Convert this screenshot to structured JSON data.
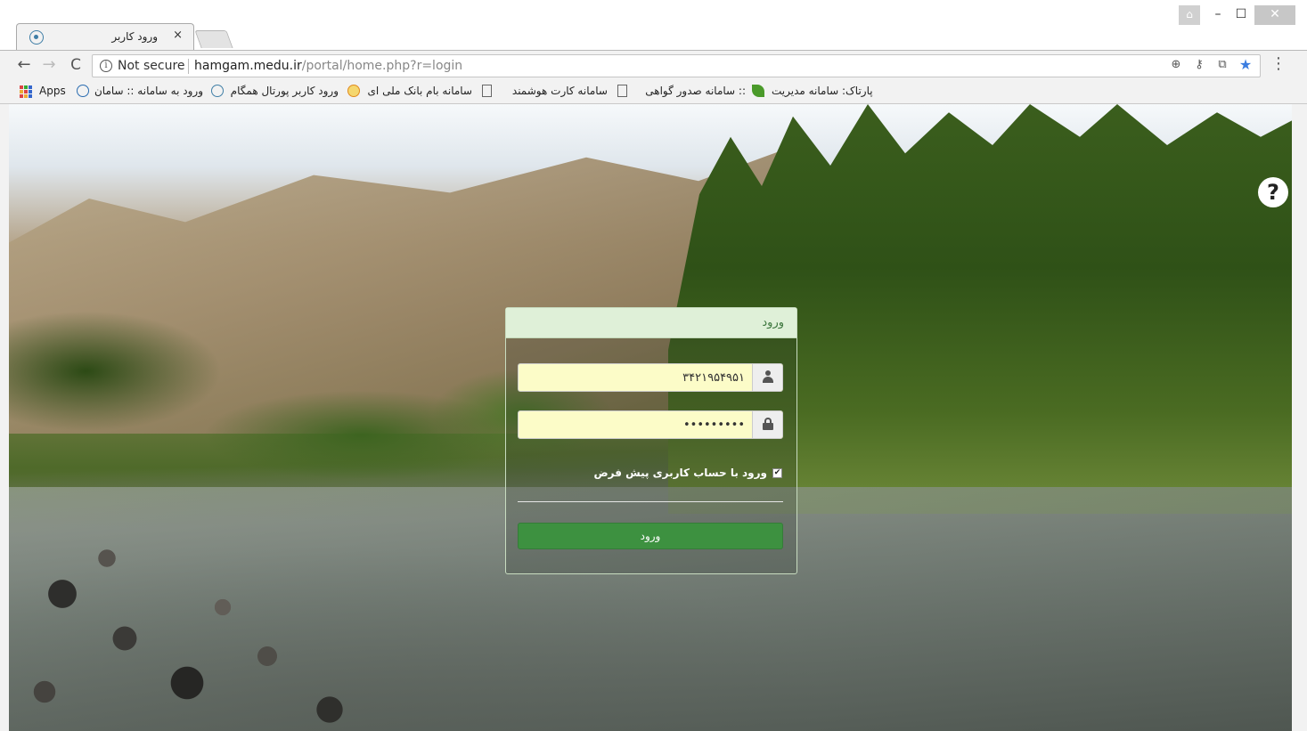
{
  "tab": {
    "title": "ورود کاربر",
    "close": "×"
  },
  "window_controls": {
    "user": "⌂",
    "minimize": "–",
    "maximize": "☐",
    "close": "✕"
  },
  "toolbar": {
    "back": "←",
    "forward": "→",
    "reload": "C",
    "security_icon": "i",
    "security_text": "Not secure",
    "url_host": "hamgam.medu.ir",
    "url_path": "/portal/home.php?r=login",
    "zoom_icon": "⊕",
    "key_icon": "⚷",
    "translate_icon": "⧉",
    "star_icon": "★",
    "menu_icon": "⋮"
  },
  "bookmarks": [
    {
      "label": "Apps",
      "icon": "apps-grid-icon"
    },
    {
      "label": "ورود به سامانه :: سامان",
      "icon": "circle-logo-icon"
    },
    {
      "label": "ورود کاربر پورتال همگام",
      "icon": "portal-icon"
    },
    {
      "label": "سامانه بام بانک ملی ای",
      "icon": "bank-icon"
    },
    {
      "label": "سامانه کارت هوشمند",
      "icon": "page-icon"
    },
    {
      "label": ":: سامانه صدور گواهی",
      "icon": "page-icon"
    },
    {
      "label": "پارتاک: سامانه مدیریت",
      "icon": "leaf-icon"
    }
  ],
  "help": "?",
  "login": {
    "title": "ورود",
    "username_value": "۳۴۲۱۹۵۴۹۵۱",
    "password_value": "•••••••••",
    "remember_checked": true,
    "remember_label": "ورود با حساب کاربری پیش فرض",
    "submit_label": "ورود"
  },
  "colors": {
    "panel_header": "#dff0d8",
    "panel_title": "#3c763d",
    "input_bg": "#fcfcc8",
    "submit_bg": "#3d9140",
    "star": "#3b7de0"
  }
}
